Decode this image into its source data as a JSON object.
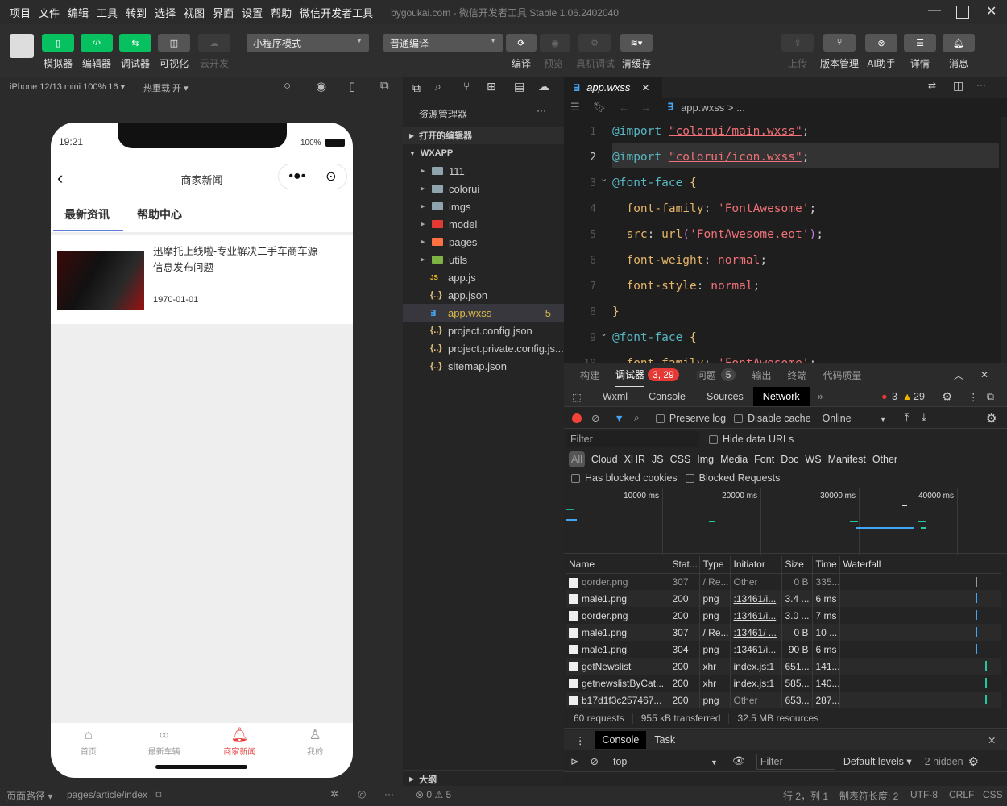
{
  "menu": {
    "items": [
      "项目",
      "文件",
      "编辑",
      "工具",
      "转到",
      "选择",
      "视图",
      "界面",
      "设置",
      "帮助",
      "微信开发者工具"
    ],
    "title": "bygoukai.com - 微信开发者工具 Stable 1.06.2402040"
  },
  "toolbar": {
    "simulator": "模拟器",
    "editor": "编辑器",
    "debugger": "调试器",
    "visual": "可视化",
    "cloud": "云开发",
    "mode": "小程序模式",
    "compile_mode": "普通编译",
    "compile": "编译",
    "preview": "预览",
    "remote_debug": "真机调试",
    "clear_cache": "清缓存",
    "upload": "上传",
    "version": "版本管理",
    "ai": "AI助手",
    "details": "详情",
    "messages": "消息"
  },
  "subbar": {
    "device": "iPhone 12/13 mini 100% 16 ▾",
    "hot_reload": "热重载 开 ▾"
  },
  "phone": {
    "time": "19:21",
    "battery": "100%",
    "nav_title": "商家新闻",
    "tabs": [
      "最新资讯",
      "帮助中心"
    ],
    "news": {
      "title": "迅摩托上线啦-专业解决二手车商车源信息发布问题",
      "date": "1970-01-01"
    },
    "tabbar": [
      {
        "label": "首页",
        "active": false
      },
      {
        "label": "最新车辆",
        "active": false
      },
      {
        "label": "商家新闻",
        "active": true
      },
      {
        "label": "我的",
        "active": false
      }
    ],
    "accent": "#e64340"
  },
  "explorer": {
    "title": "资源管理器",
    "open_editors": "打开的编辑器",
    "root": "WXAPP",
    "outline": "大纲",
    "items": [
      {
        "name": "111",
        "kind": "folder",
        "color": "#90a4ae"
      },
      {
        "name": "colorui",
        "kind": "folder",
        "color": "#90a4ae"
      },
      {
        "name": "imgs",
        "kind": "folder",
        "color": "#90a4ae"
      },
      {
        "name": "model",
        "kind": "folder",
        "color": "#e53935"
      },
      {
        "name": "pages",
        "kind": "folder",
        "color": "#ff7043"
      },
      {
        "name": "utils",
        "kind": "folder",
        "color": "#7cb342"
      },
      {
        "name": "app.js",
        "kind": "js"
      },
      {
        "name": "app.json",
        "kind": "json"
      },
      {
        "name": "app.wxss",
        "kind": "css",
        "badge": "5",
        "selected": true
      },
      {
        "name": "project.config.json",
        "kind": "json"
      },
      {
        "name": "project.private.config.js...",
        "kind": "json"
      },
      {
        "name": "sitemap.json",
        "kind": "json"
      }
    ]
  },
  "editor": {
    "tab": "app.wxss",
    "breadcrumb": "app.wxss > ...",
    "lines": [
      [
        [
          "@import",
          "kw"
        ],
        [
          " ",
          "pun"
        ],
        [
          "\"colorui/main.wxss\"",
          "str"
        ],
        [
          ";",
          "pun"
        ]
      ],
      [
        [
          "@import",
          "kw"
        ],
        [
          " ",
          "pun"
        ],
        [
          "\"colorui/icon.wxss\"",
          "str"
        ],
        [
          ";",
          "pun"
        ]
      ],
      [
        [
          "@font-face",
          "kw"
        ],
        [
          " ",
          "pun"
        ],
        [
          "{",
          "br"
        ]
      ],
      [
        [
          "  font-family",
          "prop"
        ],
        [
          ": ",
          "pun"
        ],
        [
          "'FontAwesome'",
          "val"
        ],
        [
          ";",
          "pun"
        ]
      ],
      [
        [
          "  src",
          "prop"
        ],
        [
          ": ",
          "pun"
        ],
        [
          "url",
          "fn"
        ],
        [
          "(",
          "par"
        ],
        [
          "'FontAwesome.eot'",
          "str"
        ],
        [
          ")",
          "par"
        ],
        [
          ";",
          "pun"
        ]
      ],
      [
        [
          "  font-weight",
          "prop"
        ],
        [
          ": ",
          "pun"
        ],
        [
          "normal",
          "val"
        ],
        [
          ";",
          "pun"
        ]
      ],
      [
        [
          "  font-style",
          "prop"
        ],
        [
          ": ",
          "pun"
        ],
        [
          "normal",
          "val"
        ],
        [
          ";",
          "pun"
        ]
      ],
      [
        [
          "}",
          "br"
        ]
      ],
      [
        [
          "@font-face",
          "kw"
        ],
        [
          " ",
          "pun"
        ],
        [
          "{",
          "br"
        ]
      ],
      [
        [
          "  font-family",
          "prop"
        ],
        [
          ": ",
          "pun"
        ],
        [
          "'FontAwesome'",
          "val"
        ],
        [
          ";",
          "pun"
        ]
      ]
    ],
    "line_numbers": [
      "1",
      "2",
      "3",
      "4",
      "5",
      "6",
      "7",
      "8",
      "9",
      "10"
    ]
  },
  "devtools": {
    "panel_tabs": [
      "构建",
      "调试器",
      "问题",
      "输出",
      "终端",
      "代码质量"
    ],
    "debugger_badge": "3, 29",
    "issues_badge": "5",
    "tabs": [
      "Wxml",
      "Console",
      "Sources",
      "Network"
    ],
    "active_tab": "Network",
    "errors": "3",
    "warnings": "29",
    "preserve_log": "Preserve log",
    "disable_cache": "Disable cache",
    "throttle": "Online",
    "filter_placeholder": "Filter",
    "hide_data_urls": "Hide data URLs",
    "type_filters": [
      "All",
      "Cloud",
      "XHR",
      "JS",
      "CSS",
      "Img",
      "Media",
      "Font",
      "Doc",
      "WS",
      "Manifest",
      "Other"
    ],
    "has_blocked_cookies": "Has blocked cookies",
    "blocked_requests": "Blocked Requests",
    "timeline_ticks": [
      "10000 ms",
      "20000 ms",
      "30000 ms",
      "40000 ms"
    ],
    "columns": [
      "Name",
      "Stat...",
      "Type",
      "Initiator",
      "Size",
      "Time",
      "Waterfall"
    ],
    "rows": [
      [
        "qorder.png",
        "307",
        "/ Re...",
        "Other",
        "0 B",
        "335..."
      ],
      [
        "male1.png",
        "200",
        "png",
        ":13461/i...",
        "3.4 ...",
        "6 ms"
      ],
      [
        "qorder.png",
        "200",
        "png",
        ":13461/i...",
        "3.0 ...",
        "7 ms"
      ],
      [
        "male1.png",
        "307",
        "/ Re...",
        ":13461/ ...",
        "0 B",
        "10 ..."
      ],
      [
        "male1.png",
        "304",
        "png",
        ":13461/i...",
        "90 B",
        "6 ms"
      ],
      [
        "getNewslist",
        "200",
        "xhr",
        "index.js:1",
        "651...",
        "141..."
      ],
      [
        "getnewslistByCat...",
        "200",
        "xhr",
        "index.js:1",
        "585...",
        "140..."
      ],
      [
        "b17d1f3c257467...",
        "200",
        "png",
        "Other",
        "653...",
        "287..."
      ]
    ],
    "summary": [
      "60 requests",
      "955 kB transferred",
      "32.5 MB resources"
    ],
    "drawer_tabs": [
      "Console",
      "Task"
    ],
    "context": "top",
    "console_filter": "Filter",
    "levels": "Default levels ▾",
    "hidden": "2 hidden"
  },
  "statusbar": {
    "page_path_label": "页面路径 ▾",
    "page_path": "pages/article/index",
    "errors": "0",
    "warnings": "5",
    "cursor": "行 2，列 1",
    "tab_size": "制表符长度: 2",
    "encoding": "UTF-8",
    "eol": "CRLF",
    "language": "CSS"
  }
}
